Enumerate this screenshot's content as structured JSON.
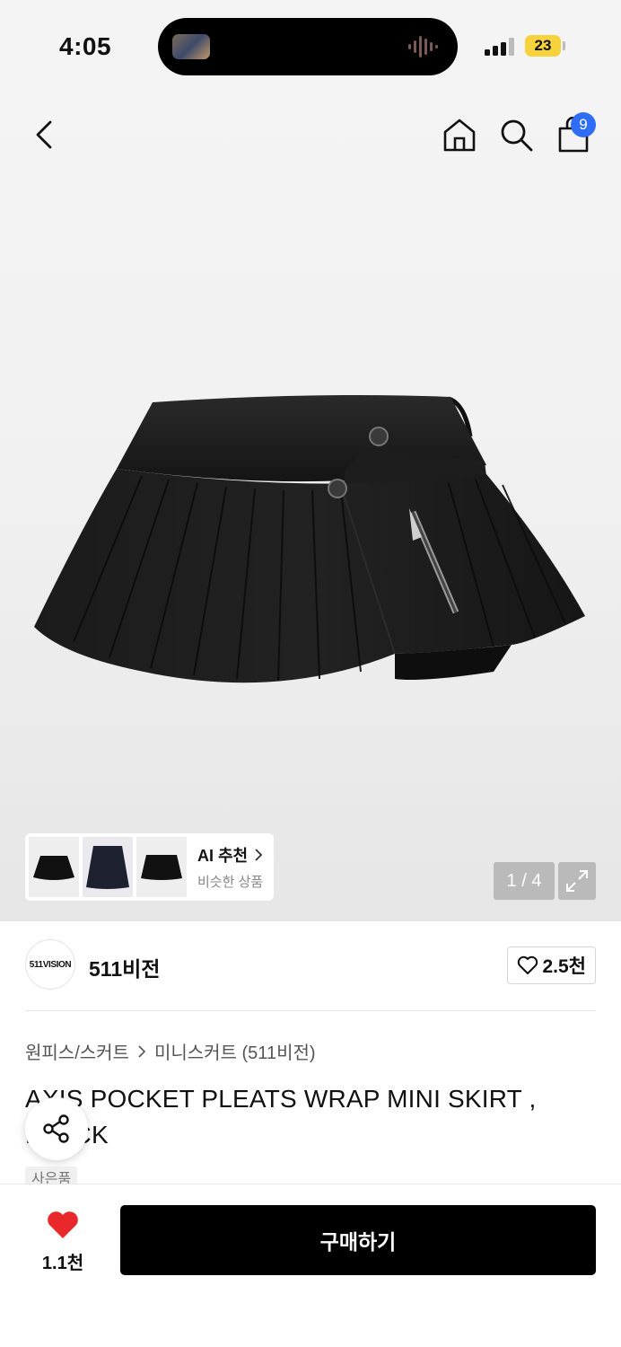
{
  "status_bar": {
    "time": "4:05",
    "battery": "23"
  },
  "nav": {
    "cart_count": "9"
  },
  "gallery": {
    "page_indicator": "1 / 4"
  },
  "ai_recommend": {
    "title": "AI 추천",
    "subtitle": "비슷한 상품"
  },
  "brand": {
    "logo_text": "511VISION",
    "name": "511비전",
    "likes": "2.5천"
  },
  "breadcrumb": {
    "category": "원피스/스커트",
    "subcategory": "미니스커트 (511비전)"
  },
  "product": {
    "title": "AXIS POCKET PLEATS WRAP MINI SKIRT , BLACK",
    "tag": "사은품"
  },
  "bottom_bar": {
    "like_count": "1.1천",
    "buy_label": "구매하기"
  },
  "colors": {
    "accent_badge": "#2f6df6",
    "heart": "#e8282b",
    "buy_button": "#000000",
    "battery": "#f6d33c"
  },
  "icons": [
    "back-icon",
    "home-icon",
    "search-icon",
    "shopping-bag-icon",
    "chevron-right-icon",
    "expand-icon",
    "heart-outline-icon",
    "share-icon",
    "heart-filled-icon"
  ]
}
